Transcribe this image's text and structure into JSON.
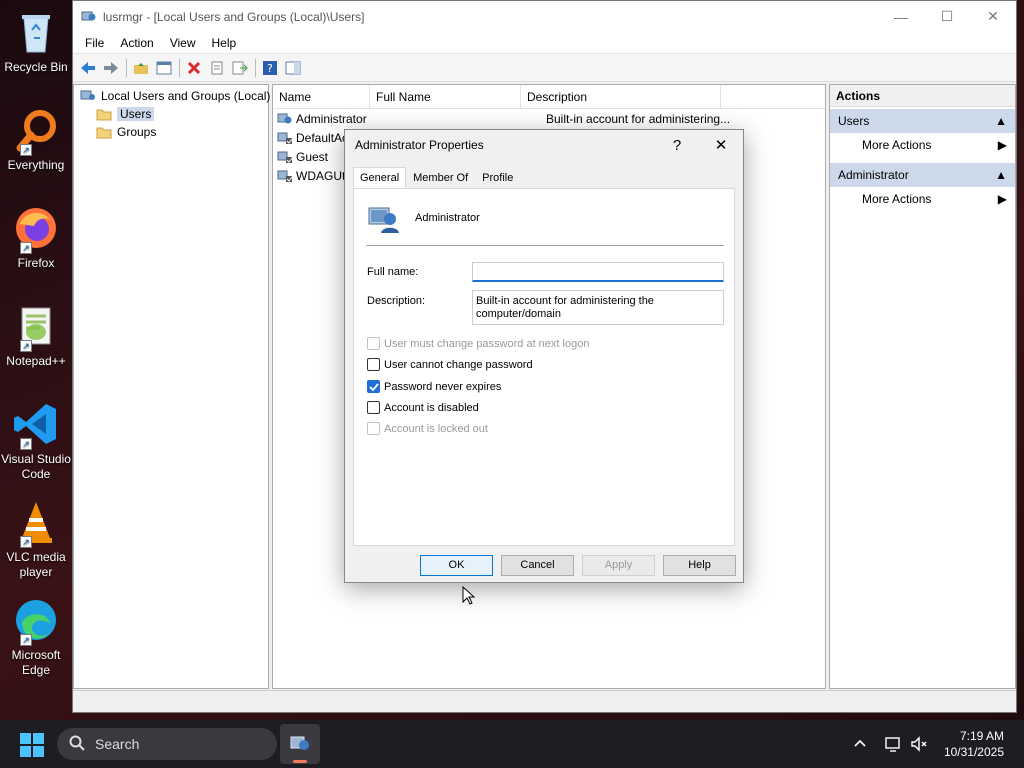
{
  "desktop": {
    "icons": [
      {
        "label": "Recycle Bin"
      },
      {
        "label": "Everything"
      },
      {
        "label": "Firefox"
      },
      {
        "label": "Notepad++"
      },
      {
        "label": "Visual Studio Code"
      },
      {
        "label": "VLC media player"
      },
      {
        "label": "Microsoft Edge"
      }
    ]
  },
  "window": {
    "title": "lusrmgr - [Local Users and Groups (Local)\\Users]",
    "menu": [
      "File",
      "Action",
      "View",
      "Help"
    ]
  },
  "tree": {
    "root": "Local Users and Groups (Local)",
    "children": [
      "Users",
      "Groups"
    ],
    "selected": "Users"
  },
  "list": {
    "columns": [
      "Name",
      "Full Name",
      "Description"
    ],
    "rows": [
      {
        "name": "Administrator",
        "full_name": "",
        "description": "Built-in account for administering..."
      },
      {
        "name": "DefaultAc",
        "full_name": "",
        "description": ""
      },
      {
        "name": "Guest",
        "full_name": "",
        "description": ""
      },
      {
        "name": "WDAGUti",
        "full_name": "",
        "description": ""
      }
    ]
  },
  "actions": {
    "header": "Actions",
    "sections": [
      {
        "title": "Users",
        "item": "More Actions"
      },
      {
        "title": "Administrator",
        "item": "More Actions"
      }
    ]
  },
  "dialog": {
    "title": "Administrator Properties",
    "help_glyph": "?",
    "close_glyph": "✕",
    "tabs": [
      "General",
      "Member Of",
      "Profile"
    ],
    "active_tab": "General",
    "user_name": "Administrator",
    "full_name_label": "Full name:",
    "full_name_value": "",
    "description_label": "Description:",
    "description_value": "Built-in account for administering the computer/domain",
    "checkboxes": [
      {
        "label": "User must change password at next logon",
        "checked": false,
        "disabled": true
      },
      {
        "label": "User cannot change password",
        "checked": false,
        "disabled": false
      },
      {
        "label": "Password never expires",
        "checked": true,
        "disabled": false
      },
      {
        "label": "Account is disabled",
        "checked": false,
        "disabled": false
      },
      {
        "label": "Account is locked out",
        "checked": false,
        "disabled": true
      }
    ],
    "buttons": {
      "ok": "OK",
      "cancel": "Cancel",
      "apply": "Apply",
      "help": "Help"
    }
  },
  "taskbar": {
    "search_placeholder": "Search",
    "time": "7:19 AM",
    "date": "10/31/2025"
  },
  "colors": {
    "selection": "#ccd9ea",
    "accent": "#1f6fd6"
  }
}
